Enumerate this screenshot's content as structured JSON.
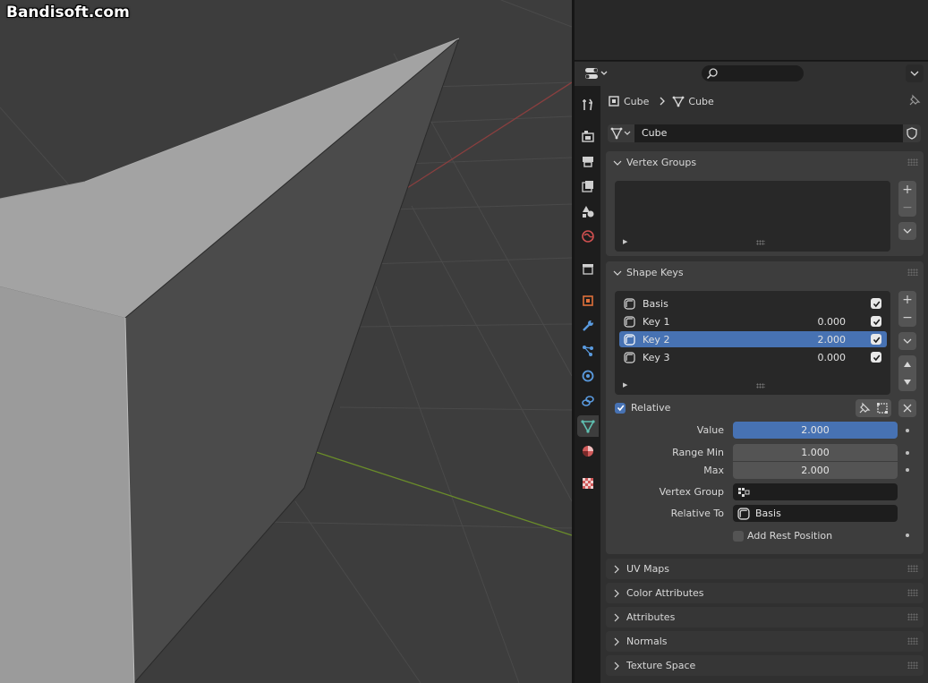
{
  "watermark": "Bandisoft.com",
  "colors": {
    "accent": "#4772b3",
    "axis_x": "#a04040",
    "axis_y": "#6a8c2a"
  },
  "header": {
    "editor_type_icon": "properties-editor-icon",
    "search_placeholder": "",
    "menu_icon": "chevron-down-icon"
  },
  "tabs": [
    {
      "name": "tool",
      "icon": "tool-icon"
    },
    {
      "name": "render",
      "icon": "render-icon"
    },
    {
      "name": "output",
      "icon": "output-icon"
    },
    {
      "name": "view-layer",
      "icon": "view-layer-icon"
    },
    {
      "name": "scene",
      "icon": "scene-icon"
    },
    {
      "name": "world",
      "icon": "world-icon"
    },
    {
      "name": "collection",
      "icon": "collection-icon"
    },
    {
      "name": "object",
      "icon": "object-icon"
    },
    {
      "name": "modifiers",
      "icon": "wrench-icon"
    },
    {
      "name": "particles",
      "icon": "particles-icon"
    },
    {
      "name": "physics",
      "icon": "physics-icon"
    },
    {
      "name": "constraints",
      "icon": "constraints-icon"
    },
    {
      "name": "data",
      "icon": "mesh-data-icon",
      "active": true
    },
    {
      "name": "material",
      "icon": "material-icon"
    },
    {
      "name": "texture",
      "icon": "texture-icon"
    }
  ],
  "breadcrumb": {
    "object": "Cube",
    "data": "Cube"
  },
  "mesh": {
    "name": "Cube"
  },
  "panels": {
    "vertex_groups": "Vertex Groups",
    "shape_keys": "Shape Keys",
    "uv_maps": "UV Maps",
    "color_attributes": "Color Attributes",
    "attributes": "Attributes",
    "normals": "Normals",
    "texture_space": "Texture Space"
  },
  "shape_keys": {
    "items": [
      {
        "name": "Basis",
        "value": "",
        "checked": true
      },
      {
        "name": "Key 1",
        "value": "0.000",
        "checked": true
      },
      {
        "name": "Key 2",
        "value": "2.000",
        "checked": true,
        "selected": true
      },
      {
        "name": "Key 3",
        "value": "0.000",
        "checked": true
      }
    ],
    "relative_label": "Relative",
    "relative_checked": true,
    "value_label": "Value",
    "value": "2.000",
    "range_min_label": "Range Min",
    "range_min": "1.000",
    "max_label": "Max",
    "max": "2.000",
    "vertex_group_label": "Vertex Group",
    "vertex_group": "",
    "relative_to_label": "Relative To",
    "relative_to": "Basis",
    "add_rest_label": "Add Rest Position",
    "add_rest_checked": false
  }
}
